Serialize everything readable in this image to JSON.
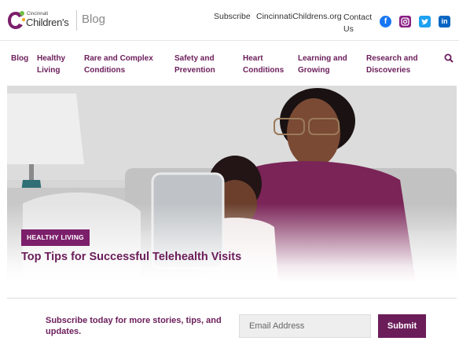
{
  "header": {
    "logo_small": "Cincinnati",
    "logo_big": "Children's",
    "blog_label": "Blog",
    "links": {
      "subscribe": "Subscribe",
      "site": "CincinnatiChildrens.org",
      "contact": "Contact Us"
    },
    "social_icons": [
      "facebook-icon",
      "instagram-icon",
      "twitter-icon",
      "linkedin-icon"
    ]
  },
  "nav": {
    "items": [
      "Blog",
      "Healthy Living",
      "Rare and Complex Conditions",
      "Safety and Prevention",
      "Heart Conditions",
      "Learning and Growing",
      "Research and Discoveries"
    ],
    "search_icon": "search-icon"
  },
  "hero": {
    "badge": "HEALTHY LIVING",
    "title": "Top Tips for Successful Telehealth Visits"
  },
  "subscribe": {
    "text": "Subscribe today for more stories, tips, and updates.",
    "email_placeholder": "Email Address",
    "submit_label": "Submit"
  },
  "colors": {
    "brand_purple": "#6b1d5a",
    "badge_purple": "#7c1f6b"
  }
}
